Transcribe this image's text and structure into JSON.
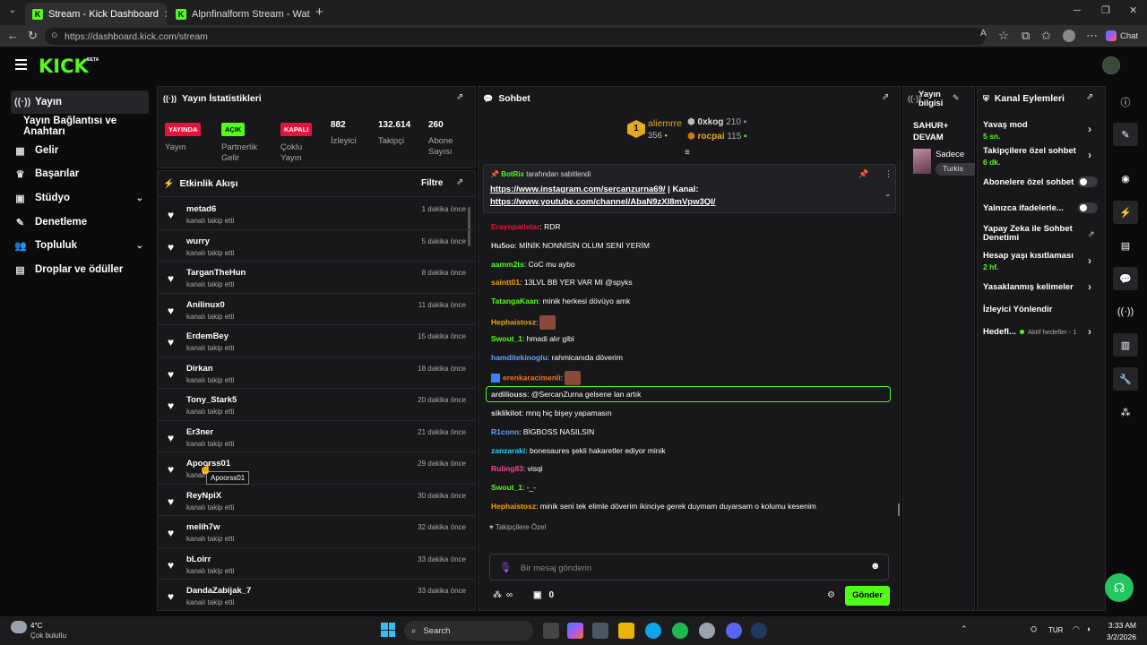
{
  "browser": {
    "tabs": [
      {
        "title": "Stream - Kick Dashboard"
      },
      {
        "title": "Alpnfinalform Stream - Watch Live"
      }
    ],
    "url": "https://dashboard.kick.com/stream",
    "chat_label": "Chat"
  },
  "kick": {
    "logo": "KICK",
    "beta": "BETA"
  },
  "sidebar": {
    "items": [
      {
        "label": "Yayın",
        "icon": "broadcast-icon"
      },
      {
        "label": "Yayın Bağlantısı ve Anahtarı"
      },
      {
        "label": "Gelir",
        "icon": "revenue-icon"
      },
      {
        "label": "Başarılar",
        "icon": "trophy-icon"
      },
      {
        "label": "Stüdyo",
        "icon": "studio-icon"
      },
      {
        "label": "Denetleme",
        "icon": "wrench-icon"
      },
      {
        "label": "Topluluk",
        "icon": "community-icon"
      },
      {
        "label": "Droplar ve ödüller",
        "icon": "drops-icon"
      }
    ]
  },
  "stats": {
    "title": "Yayın İstatistikleri",
    "items": [
      {
        "value": "YAYINDA",
        "label": "Yayın",
        "badge_color": "#e5143c"
      },
      {
        "value": "AÇIK",
        "label": "Partnerlik Gelir",
        "badge_color": "#53fc18"
      },
      {
        "value": "KAPALI",
        "label": "Çoklu Yayın",
        "badge_color": "#e5143c"
      },
      {
        "value": "882",
        "label": "İzleyici"
      },
      {
        "value": "132.614",
        "label": "Takipçi"
      },
      {
        "value": "260",
        "label": "Abone Sayısı"
      }
    ]
  },
  "activity": {
    "title": "Etkinlik Akışı",
    "filter": "Filtre",
    "tooltip": "Apoorss01",
    "rows": [
      {
        "name": "metad6",
        "sub": "kanalı takip etti",
        "time": "1 dakika önce"
      },
      {
        "name": "wurry",
        "sub": "kanalı takip etti",
        "time": "5 dakika önce"
      },
      {
        "name": "TarganTheHun",
        "sub": "kanalı takip etti",
        "time": "8 dakika önce"
      },
      {
        "name": "Anilinux0",
        "sub": "kanalı takip etti",
        "time": "11 dakika önce"
      },
      {
        "name": "ErdemBey",
        "sub": "kanalı takip etti",
        "time": "15 dakika önce"
      },
      {
        "name": "Dirkan",
        "sub": "kanalı takip etti",
        "time": "18 dakika önce"
      },
      {
        "name": "Tony_Stark5",
        "sub": "kanalı takip etti",
        "time": "20 dakika önce"
      },
      {
        "name": "Er3ner",
        "sub": "kanalı takip etti",
        "time": "21 dakika önce"
      },
      {
        "name": "Apoorss01",
        "sub": "kanalı takip etti",
        "time": "29 dakika önce"
      },
      {
        "name": "ReyNpiX",
        "sub": "kanalı takip etti",
        "time": "30 dakika önce"
      },
      {
        "name": "melih7w",
        "sub": "kanalı takip etti",
        "time": "32 dakika önce"
      },
      {
        "name": "bLoirr",
        "sub": "kanalı takip etti",
        "time": "33 dakika önce"
      },
      {
        "name": "DandaZabijak_7",
        "sub": "kanalı takip etti",
        "time": "33 dakika önce"
      }
    ]
  },
  "chat": {
    "title": "Sohbet",
    "leaders": [
      {
        "rank": "1",
        "name": "aliemrre",
        "value": "356"
      },
      {
        "name": "0xkog",
        "value": "210"
      },
      {
        "name": "rocpai",
        "value": "115"
      }
    ],
    "pinned": {
      "by": "BotRix",
      "by_suffix": "tarafından sabitlendi",
      "line1_link": "https://www.instagram.com/sercanzurna69/",
      "line1_rest": " | Kanal:",
      "line2_link": "https://www.youtube.com/channel/AbaN9zXI8mVpw3QI/"
    },
    "messages": [
      {
        "user": "Erayopatletar",
        "text": ": RDR",
        "color": "#e5143c"
      },
      {
        "user": "Hu5oo",
        "text": ": MİNİK NONNİSİN OLUM SENİ YERİM",
        "color": "#dddddd"
      },
      {
        "user": "aamm2ts",
        "text": ": CoC mu aybo",
        "color": "#53fc18"
      },
      {
        "user": "saintt01",
        "text": ": 13LVL BB YER VAR MI @spyks",
        "color": "#f59e0b"
      },
      {
        "user": "TatangaKaan",
        "text": ": minik herkesi dövüyo amk",
        "color": "#53fc18"
      },
      {
        "user": "Hephaistosz",
        "text": ":",
        "color": "#f59e0b",
        "emote": true
      },
      {
        "user": "Swout_1",
        "text": ": hmadi alır gibi",
        "color": "#53fc18"
      },
      {
        "user": "hamditekinoglu",
        "text": ": rahmicanıda döverim",
        "color": "#60a5fa"
      },
      {
        "user": "erenkaracimenli",
        "text": ":",
        "color": "#f97316",
        "emote": true
      },
      {
        "user": "ardiliouss",
        "text": ": @SercanZurna gelsene lan artık",
        "color": "#dddddd",
        "highlight": true
      },
      {
        "user": "siklikilot",
        "text": ": mnq hiç bişey yapamasın",
        "color": "#dddddd"
      },
      {
        "user": "R1conn",
        "text": ": BİGBOSS NASILSIN",
        "color": "#60a5fa"
      },
      {
        "user": "zanzaraki",
        "text": ": bonesaures şekli hakaretler ediyor minik",
        "color": "#22d3ee"
      },
      {
        "user": "Ruling83",
        "text": ": visqi",
        "color": "#ec4899"
      },
      {
        "user": "Swout_1",
        "text": ": -_-",
        "color": "#53fc18"
      },
      {
        "user": "Hephaistosz",
        "text": ": minik seni tek elimle döverim ikinciye gerek duymam duyarsam o kolumu kesenim",
        "color": "#f59e0b"
      }
    ],
    "followers_only": "Takipçilere Özel",
    "input_placeholder": "Bir mesaj gönderin",
    "points": "∞",
    "count": "0",
    "send": "Gönder"
  },
  "stream_info": {
    "title": "Yayın bilgisi",
    "game_title": "SAHUR+ DEVAM",
    "category": "Sadece",
    "tag": "Turkis"
  },
  "channel_actions": {
    "title": "Kanal Eylemleri",
    "items": [
      {
        "label": "Yavaş mod",
        "sub": "5 sn."
      },
      {
        "label": "Takipçilere özel sohbet",
        "sub": "6 dk."
      },
      {
        "label": "Abonelere özel sohbet"
      },
      {
        "label": "Yalnızca ifadelerle..."
      },
      {
        "label": "Yapay Zeka ile Sohbet Denetimi"
      },
      {
        "label": "Hesap yaşı kısıtlaması",
        "sub": "2 hf."
      },
      {
        "label": "Yasaklanmış kelimeler"
      },
      {
        "label": "İzleyici Yönlendir"
      },
      {
        "label": "Hedefl...",
        "status": "Aktif hedefler - 1"
      }
    ]
  },
  "taskbar": {
    "weather_temp": "4°C",
    "weather_desc": "Çok bulutlu",
    "search": "Search",
    "lang": "TUR",
    "time": "3:33 AM",
    "date": "3/2/2026"
  }
}
